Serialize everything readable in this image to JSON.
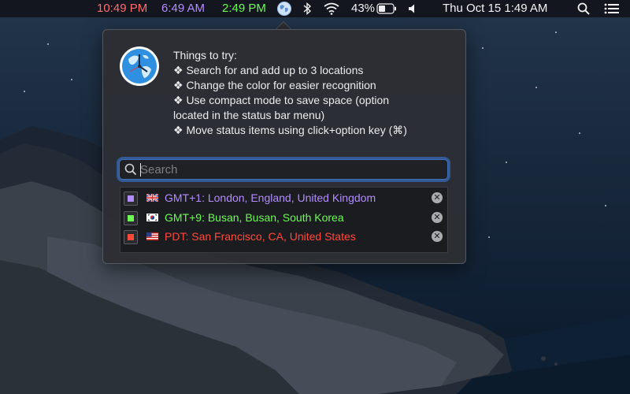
{
  "menubar": {
    "clocks": [
      {
        "time": "10:49 PM",
        "color": "#ff6a6a"
      },
      {
        "time": "6:49 AM",
        "color": "#b38cff"
      },
      {
        "time": "2:49 PM",
        "color": "#6dfa55"
      }
    ],
    "battery": "43%",
    "datetime": "Thu Oct 15  1:49 AM",
    "icons": [
      "globe-icon",
      "bluetooth-icon",
      "wifi-icon",
      "battery-icon",
      "volume-icon",
      "search-icon",
      "list-icon"
    ]
  },
  "popover": {
    "tips": [
      "Things to try:",
      "❖ Search for and add up to 3 locations",
      "❖ Change the color for easier recognition",
      "❖ Use compact mode to save space (option",
      "located in the status bar menu)",
      "❖ Move status items using click+option key (⌘)"
    ],
    "search": {
      "placeholder": "Search",
      "value": ""
    },
    "locations": [
      {
        "label": "GMT+1:  London, England, United Kingdom",
        "color": "#b38cff",
        "flag": "uk-flag-icon"
      },
      {
        "label": "GMT+9:  Busan, Busan, South Korea",
        "color": "#6dfa55",
        "flag": "korea-flag-icon"
      },
      {
        "label": "PDT:  San Francisco, CA, United States",
        "color": "#ff4a3a",
        "flag": "us-flag-icon"
      }
    ]
  }
}
